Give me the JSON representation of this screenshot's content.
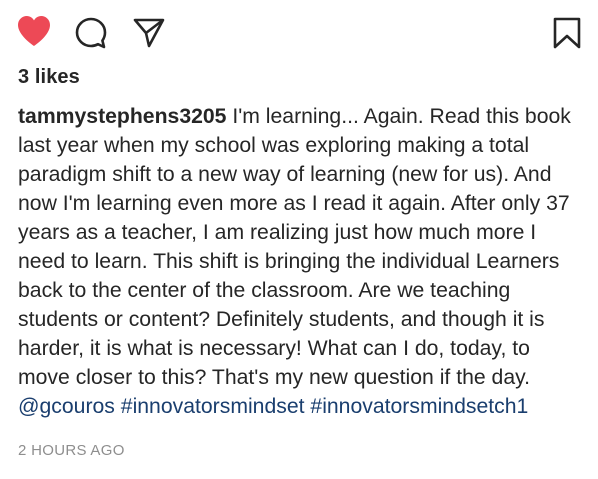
{
  "actions": {
    "like_icon": "heart-filled-icon",
    "comment_icon": "comment-icon",
    "share_icon": "paper-plane-icon",
    "save_icon": "bookmark-icon",
    "like_color": "#ed4956"
  },
  "post": {
    "likes": "3 likes",
    "username": "tammystephens3205",
    "caption_text": "I'm learning... Again. Read this book last year when my school was exploring making a total paradigm shift to a new way of learning (new for us). And now I'm learning even more as I read it again. After only 37 years as a teacher, I am realizing just how much more I need to learn. This shift is bringing the individual Learners back to the center of the classroom. Are we teaching students or content? Definitely students, and though it is harder, it is what is necessary! What can I do, today, to move closer to this? That's my new question if the day.",
    "mention": "@gcouros",
    "hashtags": [
      "#innovatorsmindset",
      "#innovatorsmindsetch1"
    ],
    "timestamp": "2 HOURS AGO",
    "link_color": "#1a3e6e"
  }
}
